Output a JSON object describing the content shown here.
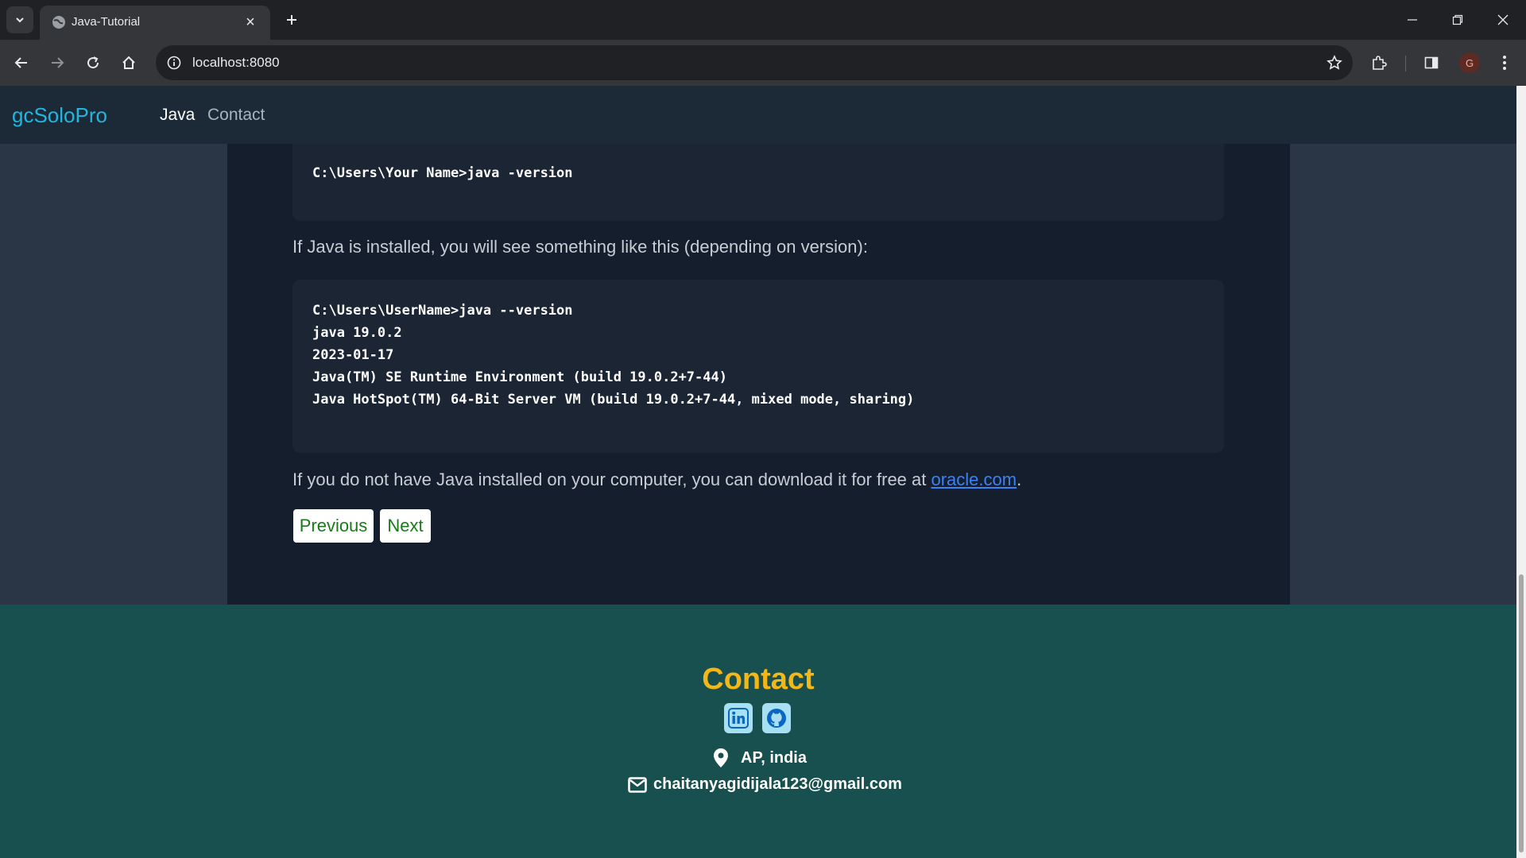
{
  "browser": {
    "tab_title": "Java-Tutorial",
    "url": "localhost:8080",
    "profile_initial": "G"
  },
  "site": {
    "brand": "gcSoloPro",
    "nav": [
      {
        "label": "Java"
      },
      {
        "label": "Contact"
      }
    ]
  },
  "article": {
    "code1": [
      "C:\\Users\\Your Name>java -version"
    ],
    "para1": "If Java is installed, you will see something like this (depending on version):",
    "code2": [
      "C:\\Users\\UserName>java --version",
      "java 19.0.2",
      "2023-01-17",
      "Java(TM) SE Runtime Environment (build 19.0.2+7-44)",
      "Java HotSpot(TM) 64-Bit Server VM (build 19.0.2+7-44, mixed mode, sharing)"
    ],
    "para2_prefix": "If you do not have Java installed on your computer, you can download it for free at ",
    "para2_link": "oracle.com",
    "para2_suffix": ".",
    "prev_label": "Previous",
    "next_label": "Next"
  },
  "contact": {
    "title": "Contact",
    "location": "AP, india",
    "email": "chaitanyagidijala123@gmail.com"
  },
  "colors": {
    "brand": "#1fb6e0",
    "contact_title": "#f5b716",
    "contact_bg": "#17504f",
    "article_bg": "#151e2c",
    "pager_text": "#1a7a1a"
  },
  "icons": [
    "tab-list-icon",
    "globe-icon",
    "close-icon",
    "plus-icon",
    "minimize-icon",
    "restore-icon",
    "back-icon",
    "forward-icon",
    "reload-icon",
    "home-icon",
    "info-icon",
    "star-icon",
    "extensions-icon",
    "sidepanel-icon",
    "more-icon",
    "linkedin-icon",
    "github-icon",
    "location-icon",
    "mail-icon"
  ]
}
